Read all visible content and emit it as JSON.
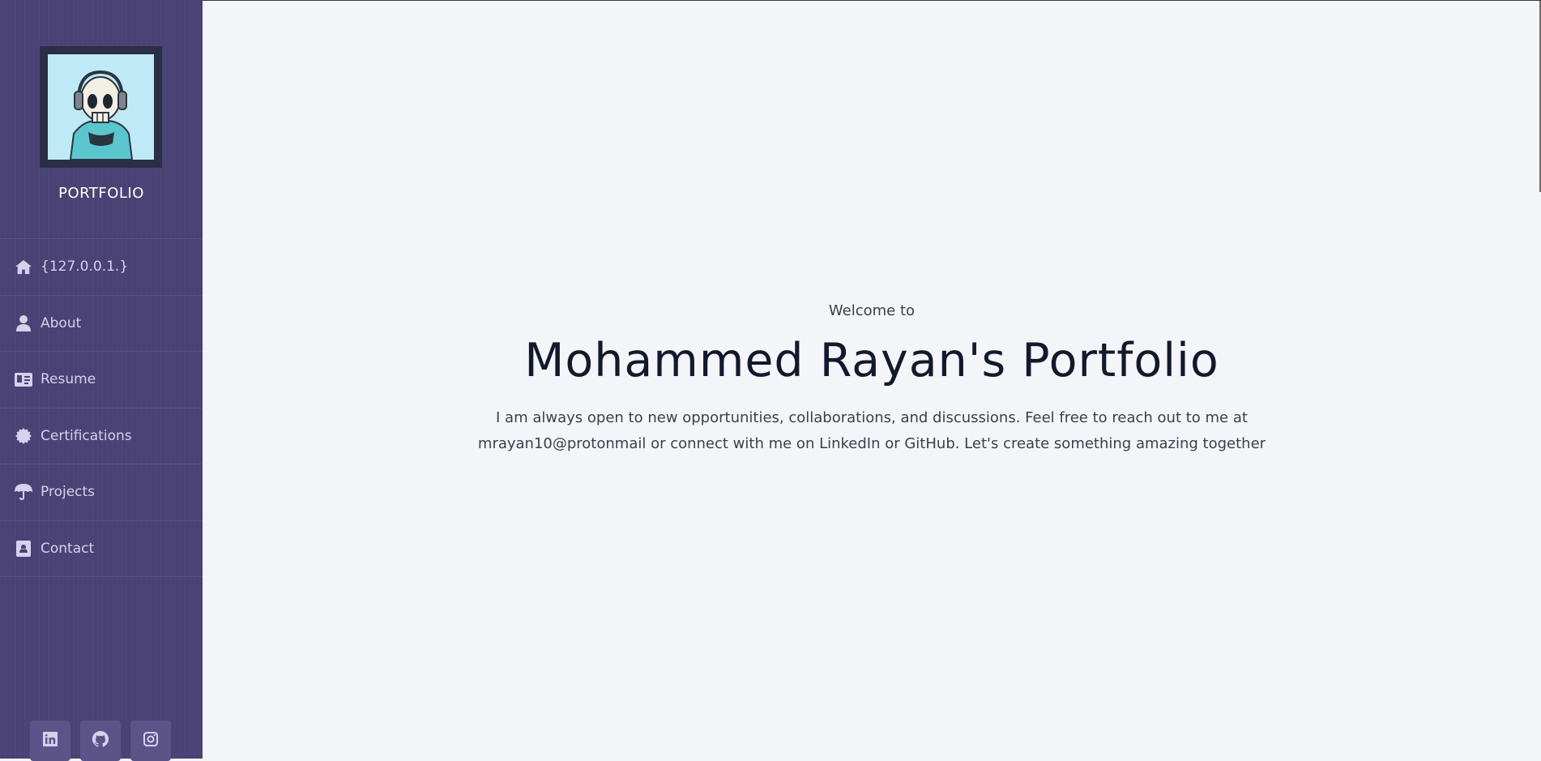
{
  "sidebar": {
    "brand": "PORTFOLIO",
    "avatar_alt": "skull-headphones-avatar",
    "items": [
      {
        "label": "{127.0.0.1.}",
        "icon": "home-icon"
      },
      {
        "label": "About",
        "icon": "user-icon"
      },
      {
        "label": "Resume",
        "icon": "id-card-icon"
      },
      {
        "label": "Certifications",
        "icon": "certificate-icon"
      },
      {
        "label": "Projects",
        "icon": "umbrella-icon"
      },
      {
        "label": "Contact",
        "icon": "address-book-icon"
      }
    ],
    "socials": [
      {
        "name": "linkedin",
        "icon": "linkedin-icon"
      },
      {
        "name": "github",
        "icon": "github-icon"
      },
      {
        "name": "instagram",
        "icon": "instagram-icon"
      }
    ]
  },
  "hero": {
    "welcome": "Welcome to",
    "title": "Mohammed Rayan's Portfolio",
    "description": "I am always open to new opportunities, collaborations, and discussions. Feel free to reach out to me at mrayan10@protonmail or connect with me on LinkedIn or GitHub. Let's create something amazing together"
  },
  "colors": {
    "sidebar_bg": "#4a4275",
    "main_bg": "#f3f5f9",
    "nav_text": "#d6d1ec",
    "title_text": "#13192b"
  }
}
